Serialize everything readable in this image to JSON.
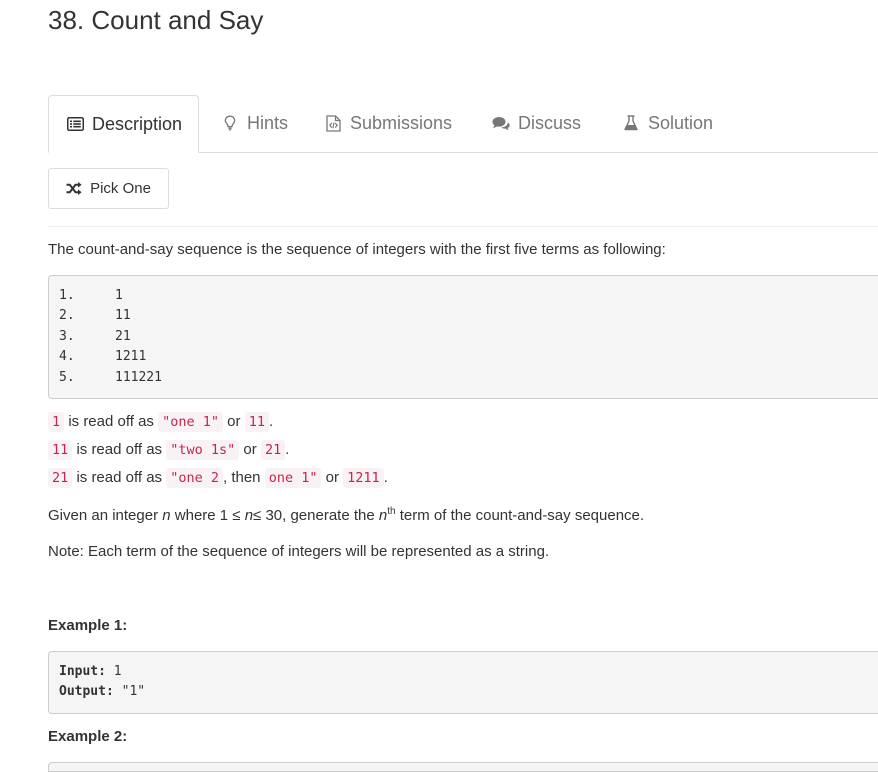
{
  "title": "38. Count and Say",
  "tabs": [
    {
      "label": "Description",
      "icon": "description-icon"
    },
    {
      "label": "Hints",
      "icon": "lightbulb-icon"
    },
    {
      "label": "Submissions",
      "icon": "code-file-icon"
    },
    {
      "label": "Discuss",
      "icon": "comments-icon"
    },
    {
      "label": "Solution",
      "icon": "flask-icon"
    }
  ],
  "pick_one": {
    "label": "Pick One",
    "icon": "shuffle-icon"
  },
  "intro": "The count-and-say sequence is the sequence of integers with the first five terms as following:",
  "sequence": [
    {
      "num": "1.",
      "value": "1"
    },
    {
      "num": "2.",
      "value": "11"
    },
    {
      "num": "3.",
      "value": "21"
    },
    {
      "num": "4.",
      "value": "1211"
    },
    {
      "num": "5.",
      "value": "111221"
    }
  ],
  "reads": [
    {
      "term": "1",
      "mid": "is read off as",
      "phrase": "\"one 1\"",
      "or": "or",
      "result": "11",
      "end": "."
    },
    {
      "term": "11",
      "mid": "is read off as",
      "phrase": "\"two 1s\"",
      "or": "or",
      "result": "21",
      "end": "."
    },
    {
      "term": "21",
      "mid": "is read off as",
      "phrase": "\"one 2",
      "then_text": ", then",
      "phrase2": "one 1\"",
      "or": "or",
      "result": "1211",
      "end": "."
    }
  ],
  "given": {
    "prefix": "Given an integer",
    "var": "n",
    "middle": "where 1 ≤",
    "var2": "n",
    "after": "≤ 30, generate the",
    "var3": "n",
    "sup": "th",
    "suffix": "term of the count-and-say sequence."
  },
  "note": "Note: Each term of the sequence of integers will be represented as a string.",
  "example1": {
    "heading": "Example 1:",
    "input_label": "Input:",
    "input_value": "1",
    "output_label": "Output:",
    "output_value": "\"1\""
  },
  "example2": {
    "heading": "Example 2:"
  },
  "colors": {
    "code_text": "#c7254e",
    "code_bg": "#f9f2f4",
    "pre_bg": "#f5f5f5",
    "border": "#dddddd"
  }
}
